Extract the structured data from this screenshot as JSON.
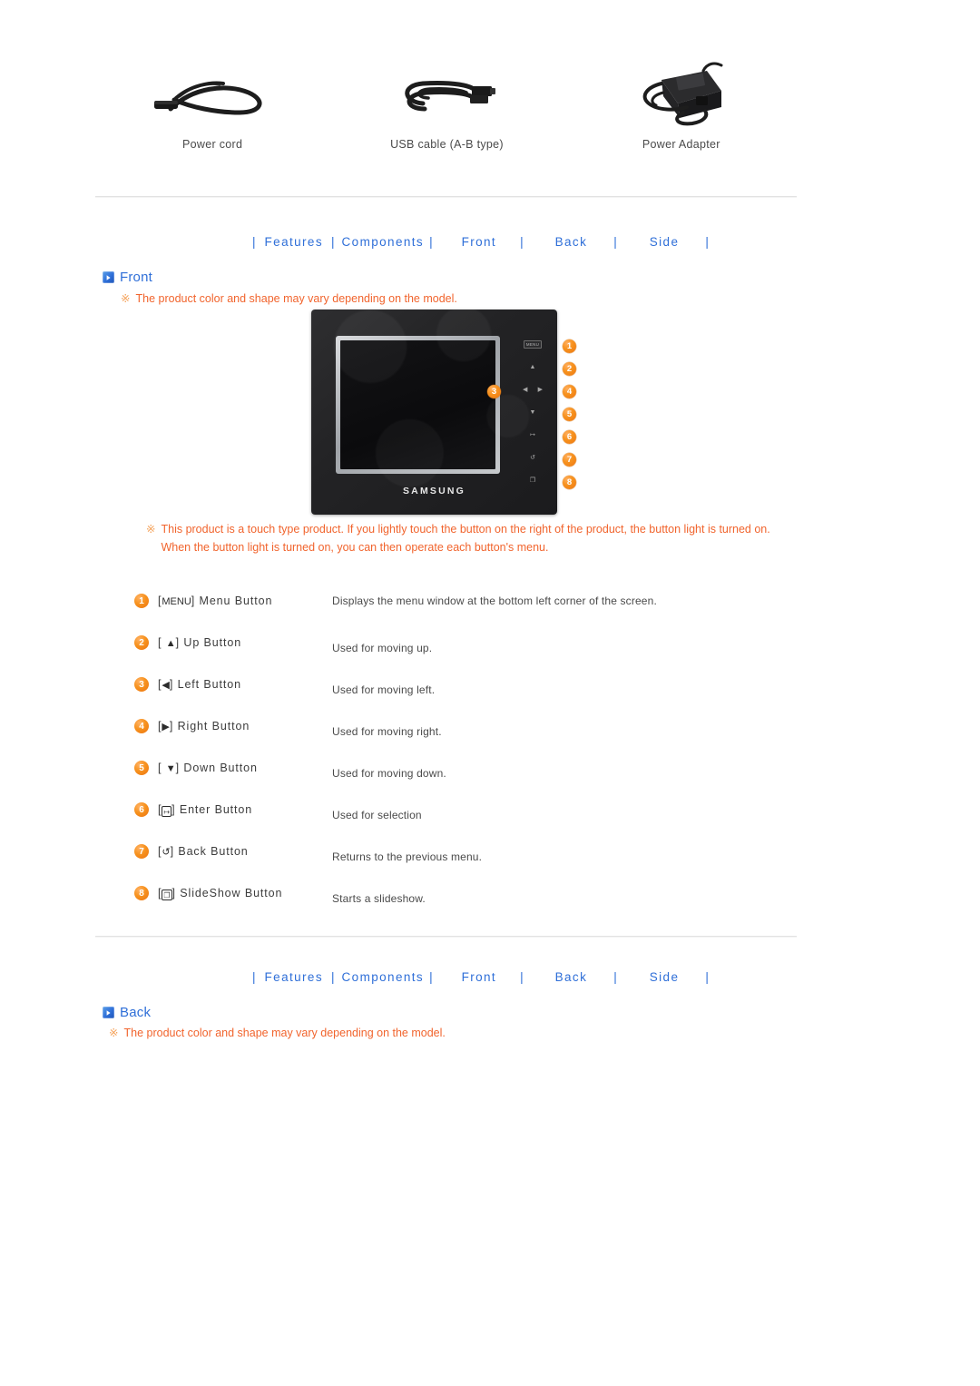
{
  "accessories": [
    {
      "label": "Power cord",
      "icon": "power-cord-photo"
    },
    {
      "label": "USB cable (A-B type)",
      "icon": "usb-cable-photo"
    },
    {
      "label": "Power Adapter",
      "icon": "power-adapter-photo"
    }
  ],
  "tabs": [
    {
      "label": "Features"
    },
    {
      "label": "Components"
    },
    {
      "label": "Front"
    },
    {
      "label": "Back"
    },
    {
      "label": "Side"
    }
  ],
  "tab_separator": "|",
  "sections": {
    "front": {
      "title": "Front",
      "bullet_icon": "blue-play-bullet-icon",
      "note_mark": "※",
      "note": "The product color and shape may vary depending on the model.",
      "touch_note_line1": "This product is a touch type product. If you lightly touch the button on the right of the product, the button light is turned on.",
      "touch_note_line2": "When the button light is turned on, you can then operate each button's menu."
    },
    "back": {
      "title": "Back",
      "bullet_icon": "blue-play-bullet-icon",
      "note_mark": "※",
      "note": "The product color and shape may vary depending on the model."
    }
  },
  "product": {
    "brand": "SAMSUNG",
    "touch_panel": [
      {
        "glyph": "MENU",
        "name": "menu-touch-key"
      },
      {
        "glyph": "▲",
        "name": "up-touch-key"
      },
      {
        "glyph": "◀ ▶",
        "name": "left-right-touch-key"
      },
      {
        "glyph": "▼",
        "name": "down-touch-key"
      },
      {
        "glyph": "↦",
        "name": "enter-touch-key"
      },
      {
        "glyph": "↺",
        "name": "back-touch-key"
      },
      {
        "glyph": "❐",
        "name": "slideshow-touch-key"
      }
    ],
    "callouts": [
      "1",
      "2",
      "3",
      "4",
      "5",
      "6",
      "7",
      "8"
    ]
  },
  "buttons": [
    {
      "num": "1",
      "glyph": "MENU",
      "glyph_style": "text",
      "label": "Menu Button",
      "desc": "Displays the menu window at the bottom left corner of the screen."
    },
    {
      "num": "2",
      "glyph": "▲",
      "glyph_style": "plain",
      "label": "Up Button",
      "desc": "Used for moving up."
    },
    {
      "num": "3",
      "glyph": "◀",
      "glyph_style": "plain",
      "label": "Left Button",
      "desc": "Used for moving left."
    },
    {
      "num": "4",
      "glyph": "▶",
      "glyph_style": "plain",
      "label": "Right Button",
      "desc": "Used for moving right."
    },
    {
      "num": "5",
      "glyph": "▼",
      "glyph_style": "plain",
      "label": "Down Button",
      "desc": "Used for moving down."
    },
    {
      "num": "6",
      "glyph": "↦",
      "glyph_style": "box",
      "label": "Enter Button",
      "desc": "Used for selection"
    },
    {
      "num": "7",
      "glyph": "↺",
      "glyph_style": "plain",
      "label": "Back Button",
      "desc": "Returns to the previous menu."
    },
    {
      "num": "8",
      "glyph": "❐",
      "glyph_style": "box",
      "label": "SlideShow Button",
      "desc": "Starts a slideshow."
    }
  ],
  "colors": {
    "link_blue": "#2f6fd8",
    "note_orange": "#f1642d",
    "callout_orange": "#f7921e",
    "body_text": "#4a4a4a",
    "divider": "#e2e2e2"
  }
}
